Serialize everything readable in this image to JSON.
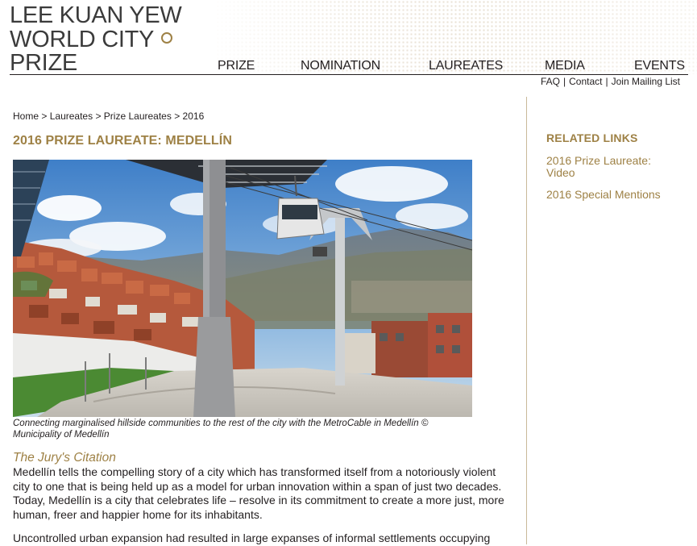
{
  "logo": {
    "line1": "LEE KUAN YEW",
    "line2": "WORLD CITY",
    "line3": "PRIZE"
  },
  "nav": {
    "items": [
      "PRIZE",
      "NOMINATION",
      "LAUREATES",
      "MEDIA",
      "EVENTS"
    ]
  },
  "utility": {
    "faq": "FAQ",
    "contact": "Contact",
    "mailing": "Join Mailing List",
    "separator": "|"
  },
  "breadcrumb": {
    "items": [
      "Home",
      "Laureates",
      "Prize Laureates",
      "2016"
    ],
    "separator": ">"
  },
  "main": {
    "title": "2016 PRIZE LAUREATE: MEDELLÍN",
    "caption": "Connecting marginalised hillside communities to the rest of the city with the MetroCable in Medellín © Municipality of Medellín",
    "citation_heading": "The Jury's Citation",
    "paragraphs": [
      "Medellín tells the compelling story of a city which has transformed itself from a notoriously violent city to one that is being held up as a model for urban innovation within a span of just two decades. Today, Medellín is a city that celebrates life – resolve in its commitment to create a more just, more human, freer and happier home for its inhabitants.",
      "Uncontrolled urban expansion had resulted in large expanses of informal settlements occupying"
    ]
  },
  "sidebar": {
    "title": "RELATED LINKS",
    "links": [
      "2016 Prize Laureate: Video",
      "2016 Special Mentions"
    ]
  },
  "colors": {
    "accent": "#9e8145",
    "text": "#231f20",
    "divider": "#c9b99a"
  }
}
